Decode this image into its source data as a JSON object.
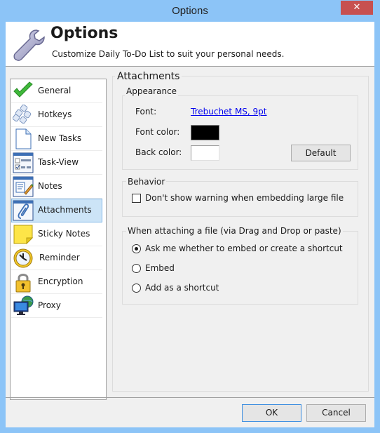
{
  "window": {
    "title": "Options",
    "close_icon": "close-icon"
  },
  "header": {
    "title": "Options",
    "subtitle": "Customize Daily To-Do List to suit your personal needs.",
    "icon": "wrench-icon"
  },
  "sidebar": {
    "items": [
      {
        "label": "General",
        "icon": "checkmark-icon",
        "selected": false
      },
      {
        "label": "Hotkeys",
        "icon": "keyboard-keys-icon",
        "selected": false
      },
      {
        "label": "New Tasks",
        "icon": "blank-document-icon",
        "selected": false
      },
      {
        "label": "Task-View",
        "icon": "task-view-icon",
        "selected": false
      },
      {
        "label": "Notes",
        "icon": "notes-icon",
        "selected": false
      },
      {
        "label": "Attachments",
        "icon": "paperclip-icon",
        "selected": true
      },
      {
        "label": "Sticky Notes",
        "icon": "sticky-note-icon",
        "selected": false
      },
      {
        "label": "Reminder",
        "icon": "alarm-clock-icon",
        "selected": false
      },
      {
        "label": "Encryption",
        "icon": "padlock-icon",
        "selected": false
      },
      {
        "label": "Proxy",
        "icon": "network-monitor-icon",
        "selected": false
      }
    ]
  },
  "main": {
    "title": "Attachments",
    "appearance": {
      "title": "Appearance",
      "font_label": "Font:",
      "font_value": "Trebuchet MS, 9pt",
      "font_color_label": "Font color:",
      "font_color": "#000000",
      "back_color_label": "Back color:",
      "back_color": "#ffffff",
      "default_button": "Default"
    },
    "behavior": {
      "title": "Behavior",
      "checkbox_label": "Don't show warning when embedding large file",
      "checked": false
    },
    "attach_mode": {
      "title": "When attaching a file (via Drag and Drop or paste)",
      "options": [
        {
          "label": "Ask me whether to embed or create a shortcut",
          "selected": true
        },
        {
          "label": "Embed",
          "selected": false
        },
        {
          "label": "Add as a shortcut",
          "selected": false
        }
      ]
    }
  },
  "footer": {
    "ok": "OK",
    "cancel": "Cancel"
  }
}
